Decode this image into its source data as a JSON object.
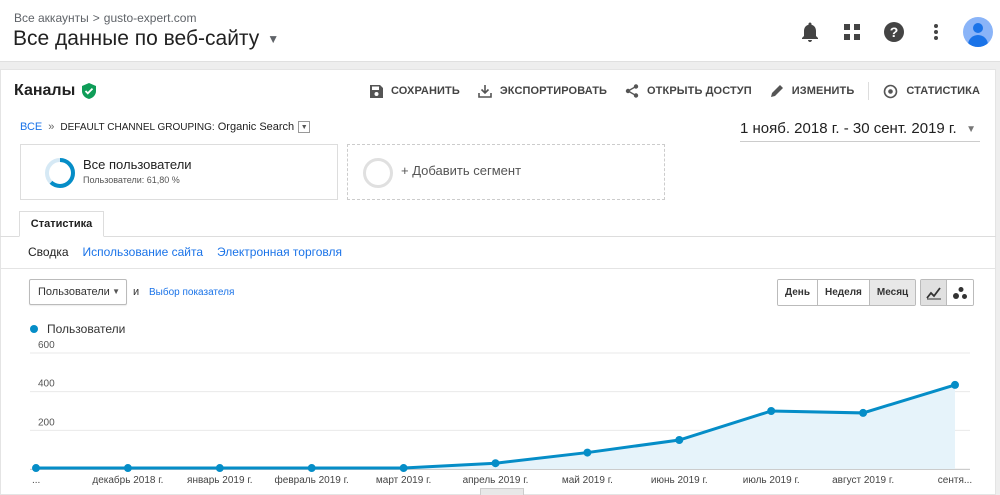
{
  "header": {
    "breadcrumb_accounts": "Все аккаунты",
    "breadcrumb_sep": ">",
    "breadcrumb_property": "gusto-expert.com",
    "view_title": "Все данные по веб-сайту",
    "icons": [
      "bell-icon",
      "apps-grid-icon",
      "help-icon",
      "more-vert-icon",
      "avatar"
    ]
  },
  "report": {
    "title": "Каналы",
    "toolbar": {
      "save": "СОХРАНИТЬ",
      "export": "ЭКСПОРТИРОВАТЬ",
      "share": "ОТКРЫТЬ ДОСТУП",
      "edit": "ИЗМЕНИТЬ",
      "insights": "СТАТИСТИКА"
    }
  },
  "segment_path": {
    "all": "ВСЕ",
    "sep": "»",
    "grouping": "DEFAULT CHANNEL GROUPING:",
    "value": "Organic Search"
  },
  "date_range": "1 нояб. 2018 г. - 30 сент. 2019 г.",
  "segments": {
    "active_name": "Все пользователи",
    "active_sub": "Пользователи: 61,80 %",
    "active_fraction": 0.618,
    "add_label": "+ Добавить сегмент"
  },
  "tabs": {
    "main": "Статистика",
    "sub": [
      "Сводка",
      "Использование сайта",
      "Электронная торговля"
    ]
  },
  "controls": {
    "metric": "Пользователи",
    "and": "и",
    "choose_metric": "Выбор показателя",
    "periods": [
      "День",
      "Неделя",
      "Месяц"
    ],
    "selected_period": "Месяц"
  },
  "colors": {
    "series": "#058dc7",
    "area": "#e6f3fa",
    "accent": "#1a73e8",
    "verified": "#0f9d58"
  },
  "chart_data": {
    "type": "area",
    "series": [
      {
        "name": "Пользователи",
        "values": [
          5,
          5,
          5,
          5,
          5,
          30,
          85,
          150,
          300,
          290,
          435
        ]
      }
    ],
    "categories": [
      "...",
      "декабрь 2018 г.",
      "январь 2019 г.",
      "февраль 2019 г.",
      "март 2019 г.",
      "апрель 2019 г.",
      "май 2019 г.",
      "июнь 2019 г.",
      "июль 2019 г.",
      "август 2019 г.",
      "сентя..."
    ],
    "yticks": [
      "200",
      "400",
      "600"
    ],
    "ylim": [
      0,
      600
    ],
    "grid": true
  }
}
